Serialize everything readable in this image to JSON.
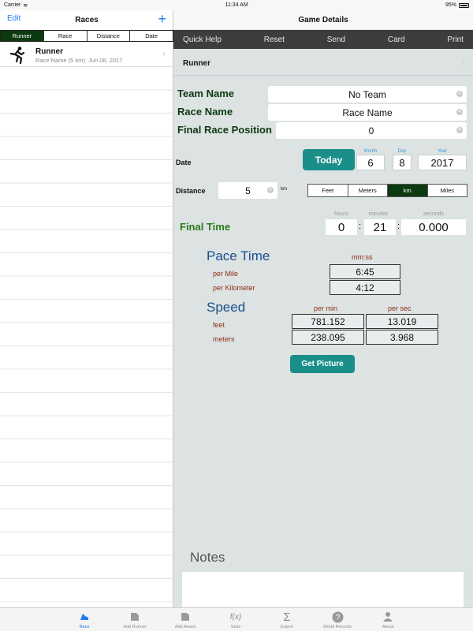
{
  "status": {
    "carrier": "Carrier",
    "time": "11:34 AM",
    "battery": "95%"
  },
  "left": {
    "edit": "Edit",
    "title": "Races",
    "add": "+",
    "segments": [
      "Runner",
      "Race",
      "Distance",
      "Date"
    ],
    "runner": {
      "name": "Runner",
      "subtitle": "Race Name (5 km): Jun 08, 2017"
    }
  },
  "right": {
    "title": "Game Details",
    "toolbar": [
      "Quick Help",
      "Reset",
      "Send",
      "Card",
      "Print"
    ],
    "runner_label": "Runner",
    "team_label": "Team Name",
    "team_value": "No Team",
    "race_label": "Race Name",
    "race_value": "Race Name",
    "position_label": "Final Race Position",
    "position_value": "0",
    "date_label": "Date",
    "today": "Today",
    "month_cap": "Month",
    "day_cap": "Day",
    "year_cap": "Year",
    "month": "6",
    "day": "8",
    "year": "2017",
    "distance_label": "Distance",
    "distance_value": "5",
    "distance_unit": "km",
    "units": [
      "Feet",
      "Meters",
      "km",
      "Miles"
    ],
    "final_time_label": "Final Time",
    "hours_cap": "hours",
    "minutes_cap": "minutes",
    "seconds_cap": "seconds",
    "hours": "0",
    "minutes": "21",
    "seconds": "0.000",
    "pace_title": "Pace Time",
    "pace_units": "mm:ss",
    "per_mile": "per Mile",
    "per_km": "per Kilometer",
    "pace_mile": "6:45",
    "pace_km": "4:12",
    "speed_title": "Speed",
    "per_min": "per min",
    "per_sec": "per sec",
    "feet": "feet",
    "meters": "meters",
    "feet_min": "781.152",
    "feet_sec": "13.019",
    "meters_min": "238.095",
    "meters_sec": "3.968",
    "get_picture": "Get Picture",
    "notes": "Notes"
  },
  "tabs": [
    "Race",
    "Add Runner",
    "Add Award",
    "Stats",
    "Export",
    "World Records",
    "About"
  ],
  "colors": {
    "accent": "#1e7cf0",
    "teal": "#1a8f8a",
    "dark_green": "#0c3a10"
  }
}
